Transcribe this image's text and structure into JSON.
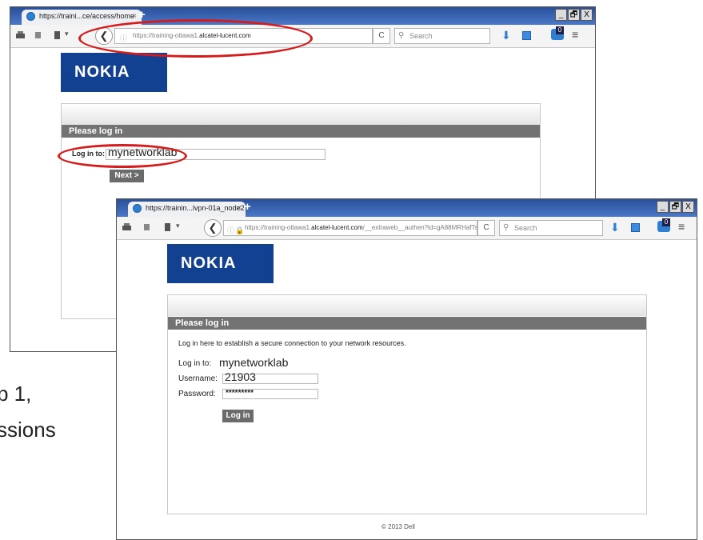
{
  "slide_text": {
    "line1": "p 1,",
    "line2": "ssions"
  },
  "colors": {
    "annotation_oval": "#d41c1c",
    "tabbar": "#2a4f99",
    "logo_bg": "#124191",
    "banner_bg": "#737373",
    "button_bg": "#6b6b6b"
  },
  "window1": {
    "tab_title": "https://traini...ce/access/home",
    "tab_close": "×",
    "new_tab": "+",
    "url": "https://training-ottawa1.",
    "url_domain": "alcatel-lucent.com",
    "reload": "C",
    "search_placeholder": "Search",
    "notif_count": "0",
    "window_buttons": [
      "_",
      "🗗",
      "X"
    ],
    "logo": "NOKIA",
    "banner": "Please log in",
    "login_to_label": "Log in to:",
    "login_to_value": "mynetworklab",
    "next_button": "Next >"
  },
  "window2": {
    "tab_title": "https://trainin...lvpn-01a_node2",
    "tab_close": "×",
    "new_tab": "+",
    "url": "https://training-ottawa1.",
    "url_domain": "alcatel-lucent.com",
    "url_rest": "/__extraweb__authen?id=gA88MRHafTs%3",
    "reload": "C",
    "search_placeholder": "Search",
    "notif_count": "0",
    "window_buttons": [
      "_",
      "🗗",
      "X"
    ],
    "logo": "NOKIA",
    "banner": "Please log in",
    "intro": "Log in here to establish a secure connection to your network resources.",
    "login_to_label": "Log in to:",
    "login_to_value": "mynetworklab",
    "username_label": "Username:",
    "username_value": "21903",
    "password_label": "Password:",
    "password_value": "*********",
    "login_button": "Log in",
    "footer": "© 2013 Dell"
  }
}
